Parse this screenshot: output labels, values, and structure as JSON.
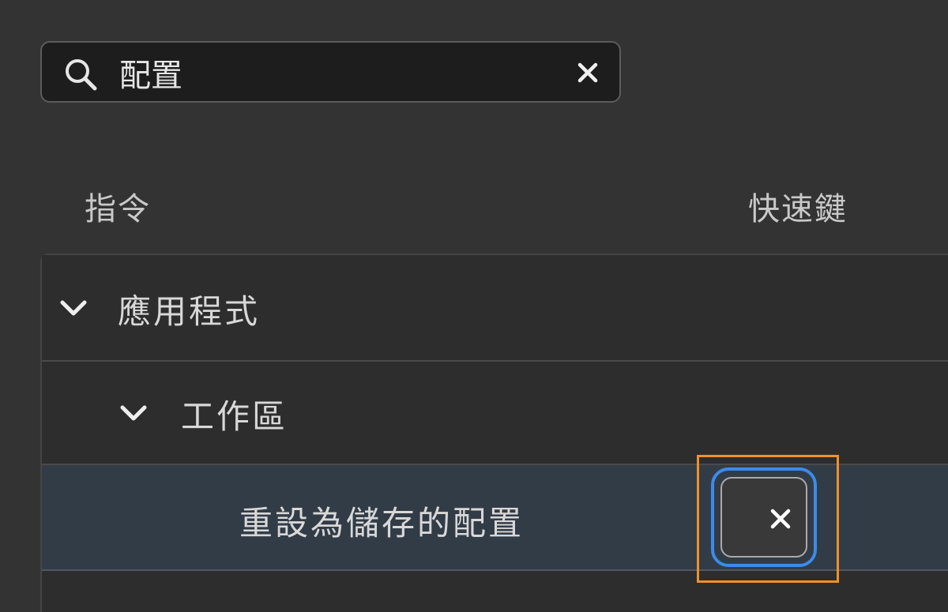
{
  "search": {
    "value": "配置",
    "icon": "search-icon",
    "clear_icon": "close-icon"
  },
  "columns": {
    "command": "指令",
    "shortcut": "快速鍵"
  },
  "tree": {
    "group": {
      "label": "應用程式",
      "icon": "chevron-down-icon"
    },
    "subgroup": {
      "label": "工作區",
      "icon": "chevron-down-icon"
    },
    "item": {
      "label": "重設為儲存的配置",
      "shortcut_clear_icon": "close-icon"
    }
  },
  "colors": {
    "background": "#333333",
    "selected_row": "#323c47",
    "focus_ring": "#3d8be8",
    "highlight": "#f0902a"
  }
}
